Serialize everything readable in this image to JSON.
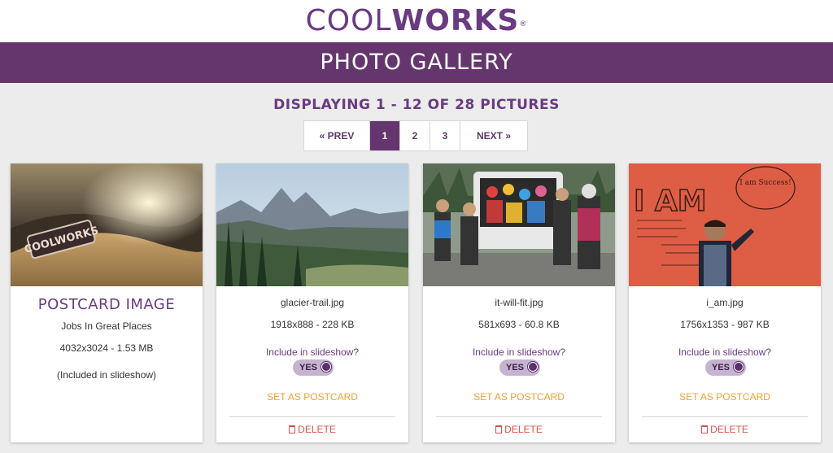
{
  "header": {
    "logo_cool": "COOL",
    "logo_works": "WORKS",
    "logo_mark": "®",
    "title": "PHOTO GALLERY"
  },
  "gallery": {
    "display_text": "DISPLAYING 1 - 12 OF 28 PICTURES"
  },
  "pagination": {
    "prev": "« PREV",
    "pages": [
      "1",
      "2",
      "3"
    ],
    "active_page": "1",
    "next": "NEXT »"
  },
  "cards": [
    {
      "title": "POSTCARD IMAGE",
      "subtitle": "Jobs In Great Places",
      "meta": "4032x3024 - 1.53 MB",
      "note": "(Included in slideshow)",
      "photo_badge": "COOLWORKS"
    },
    {
      "filename": "glacier-trail.jpg",
      "meta": "1918x888 - 228 KB",
      "include_label": "Include in slideshow?",
      "toggle": "YES",
      "postcard": "SET AS POSTCARD",
      "delete": "DELETE"
    },
    {
      "filename": "it-will-fit.jpg",
      "meta": "581x693 - 60.8 KB",
      "include_label": "Include in slideshow?",
      "toggle": "YES",
      "postcard": "SET AS POSTCARD",
      "delete": "DELETE"
    },
    {
      "filename": "i_am.jpg",
      "meta": "1756x1353 - 987 KB",
      "include_label": "Include in slideshow?",
      "toggle": "YES",
      "postcard": "SET AS POSTCARD",
      "delete": "DELETE",
      "photo_wall_text": "I AM",
      "photo_bubble_text": "I am Success!"
    }
  ],
  "colors": {
    "brand_purple": "#65366e",
    "postcard_orange": "#f0a030",
    "delete_red": "#d9534f"
  }
}
